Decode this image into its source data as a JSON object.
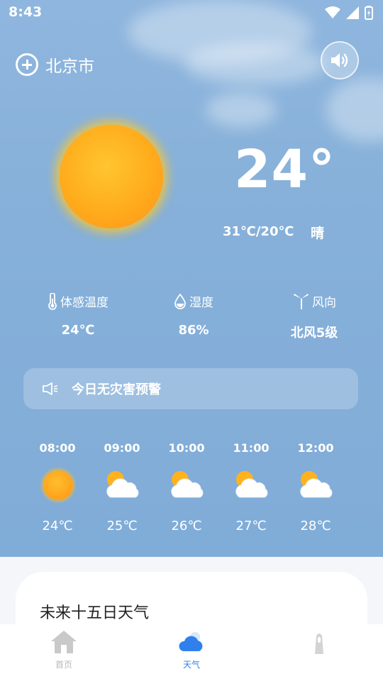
{
  "status_bar": {
    "time": "8:43"
  },
  "header": {
    "city": "北京市"
  },
  "current": {
    "temperature": "24°",
    "range": "31℃/20℃",
    "condition": "晴"
  },
  "stats": [
    {
      "label": "体感温度",
      "value": "24℃",
      "icon": "thermometer-icon"
    },
    {
      "label": "湿度",
      "value": "86%",
      "icon": "droplet-icon"
    },
    {
      "label": "风向",
      "value": "北风5级",
      "icon": "wind-turbine-icon"
    }
  ],
  "alert": {
    "text": "今日无灾害预警",
    "icon": "speaker-icon"
  },
  "hourly": [
    {
      "time": "08:00",
      "temp": "24℃",
      "icon": "sun-icon"
    },
    {
      "time": "09:00",
      "temp": "25℃",
      "icon": "partly-cloudy-icon"
    },
    {
      "time": "10:00",
      "temp": "26℃",
      "icon": "partly-cloudy-icon"
    },
    {
      "time": "11:00",
      "temp": "27℃",
      "icon": "partly-cloudy-icon"
    },
    {
      "time": "12:00",
      "temp": "28℃",
      "icon": "partly-cloudy-icon"
    }
  ],
  "forecast_card": {
    "title": "未来十五日天气"
  },
  "tabs": [
    {
      "label": "首页",
      "icon": "home-icon"
    },
    {
      "label": "天气",
      "icon": "cloud-icon"
    },
    {
      "label": "",
      "icon": "lighthouse-icon"
    }
  ],
  "colors": {
    "sky": "#86b0d9",
    "active_tab": "#2f80ed",
    "inactive_tab": "#b8b8b8"
  }
}
